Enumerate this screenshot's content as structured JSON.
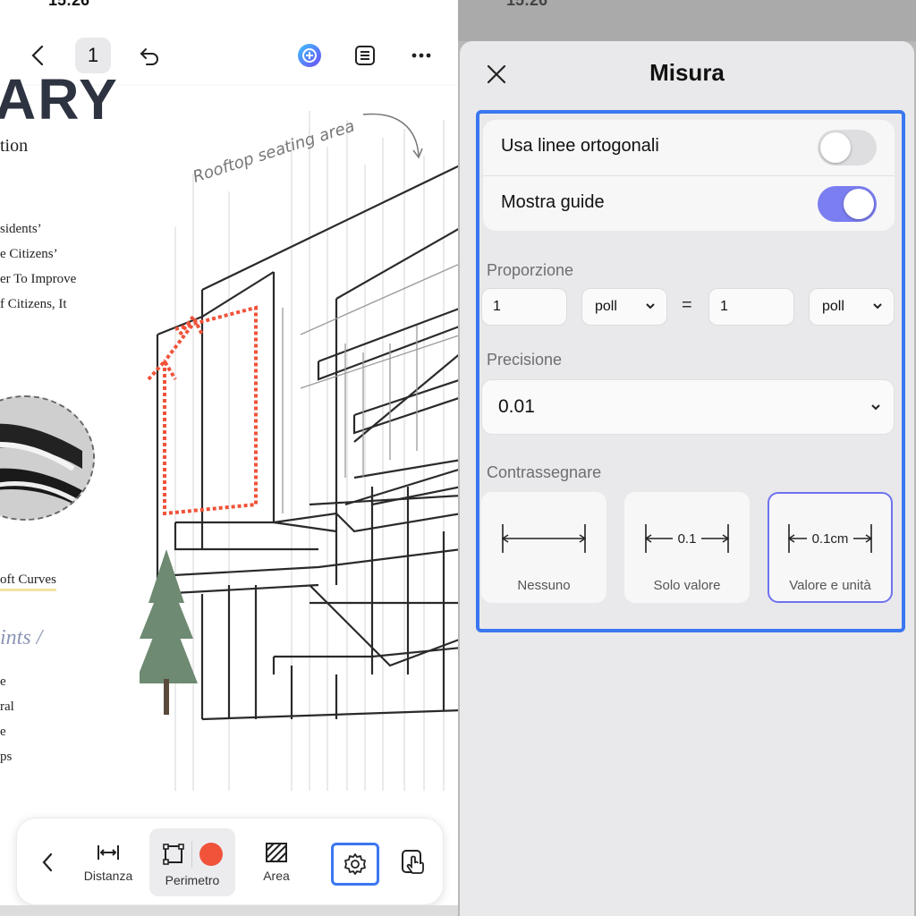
{
  "left": {
    "status_time": "15:26",
    "topbar": {
      "page_number": "1",
      "back_icon": "chevron-left-icon",
      "undo_icon": "undo-icon",
      "ai_icon": "ai-assistant-icon",
      "list_icon": "list-icon",
      "more_icon": "more-icon"
    },
    "document": {
      "title": "ARY",
      "subtitle": "tion",
      "lines": [
        "sidents’",
        "e Citizens’",
        "er To Improve",
        "f Citizens, It"
      ],
      "soft_curves": "oft Curves",
      "section_heading": "ints /",
      "list_items": [
        "e",
        "ral",
        "e",
        "ps"
      ],
      "sketch_annotation": "Rooftop seating area"
    },
    "toolbar": {
      "back_icon": "chevron-left-icon",
      "tools": [
        {
          "label": "Distanza",
          "icon": "distance-icon"
        },
        {
          "label": "Perimetro",
          "icon": "perimeter-icon"
        },
        {
          "label": "Area",
          "icon": "area-icon"
        }
      ],
      "color_dot": "#f0533a",
      "settings_icon": "gear-icon",
      "touch_icon": "touch-icon"
    }
  },
  "sheet": {
    "title": "Misura",
    "close_icon": "close-icon",
    "toggles": [
      {
        "label": "Usa linee ortogonali",
        "on": false
      },
      {
        "label": "Mostra guide",
        "on": true
      }
    ],
    "proportion": {
      "label": "Proporzione",
      "left_value": "1",
      "left_unit": "poll",
      "equals": "=",
      "right_value": "1",
      "right_unit": "poll"
    },
    "precision": {
      "label": "Precisione",
      "value": "0.01"
    },
    "marking": {
      "label": "Contrassegnare",
      "options": [
        {
          "caption": "Nessuno",
          "text": ""
        },
        {
          "caption": "Solo valore",
          "text": "0.1"
        },
        {
          "caption": "Valore e unità",
          "text": "0.1cm",
          "selected": true
        }
      ]
    }
  },
  "colors": {
    "accent": "#3a77f0",
    "toggle_on": "#7b7ef0",
    "measure_red": "#f0533a"
  }
}
